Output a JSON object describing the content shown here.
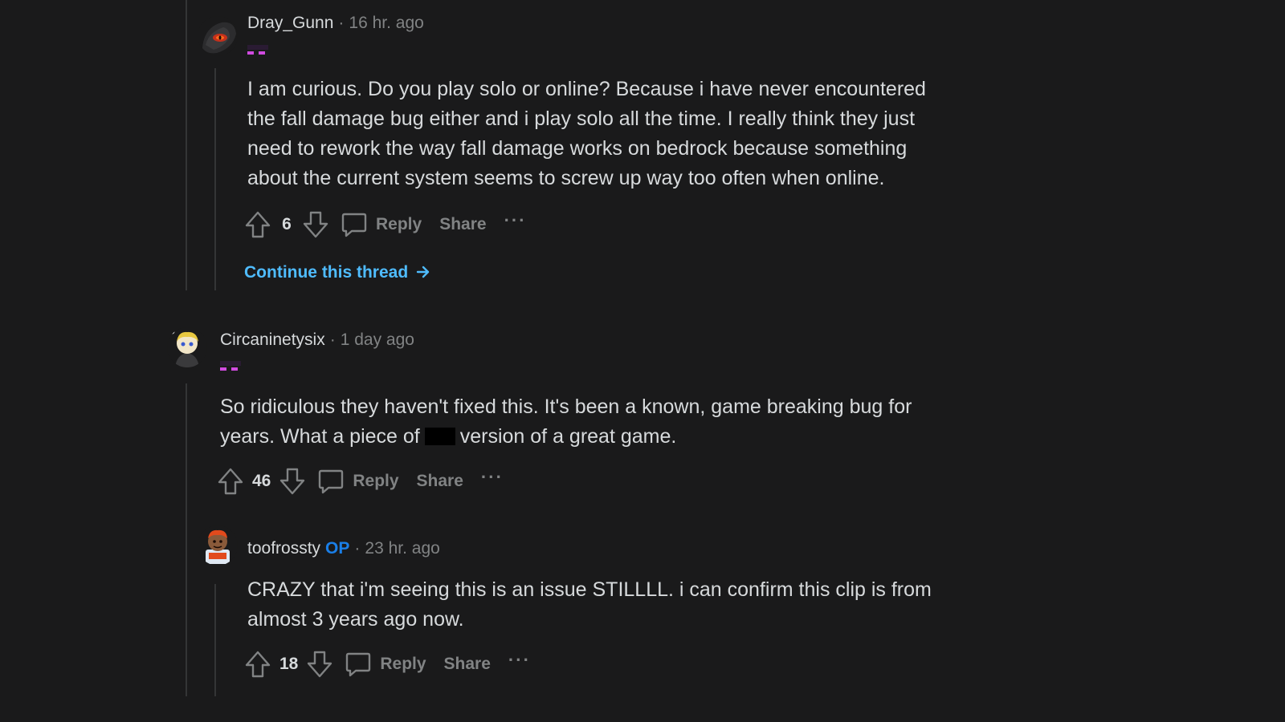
{
  "comments": [
    {
      "username": "Dray_Gunn",
      "time": "16 hr. ago",
      "body": "I am curious. Do you play solo or online? Because i have never encountered the fall damage bug either and i play solo all the time. I really think they just need to rework the way fall damage works on bedrock because something about the current system seems to screw up way too often when online.",
      "score": "6",
      "reply_label": "Reply",
      "share_label": "Share",
      "more_label": "···",
      "continue_label": "Continue this thread"
    },
    {
      "username": "Circaninetysix",
      "time": "1 day ago",
      "body_before": "So ridiculous they haven't fixed this. It's been a known, game breaking bug for years. What a piece of",
      "body_after": "version of a great game.",
      "score": "46",
      "reply_label": "Reply",
      "share_label": "Share",
      "more_label": "···"
    },
    {
      "username": "toofrossty",
      "op_badge": "OP",
      "time": "23 hr. ago",
      "body": "CRAZY that i'm seeing this is an issue STILLLL. i can confirm this clip is from almost 3 years ago now.",
      "score": "18",
      "reply_label": "Reply",
      "share_label": "Share",
      "more_label": "···"
    }
  ],
  "separator": "·",
  "colors": {
    "background": "#1a1a1b",
    "text": "#d7dadc",
    "muted": "#818384",
    "link": "#4fbcff",
    "op": "#1a7fe8",
    "flair": "#d04be0"
  },
  "icons": [
    "upvote-icon",
    "downvote-icon",
    "comment-bubble-icon",
    "arrow-right-icon"
  ]
}
